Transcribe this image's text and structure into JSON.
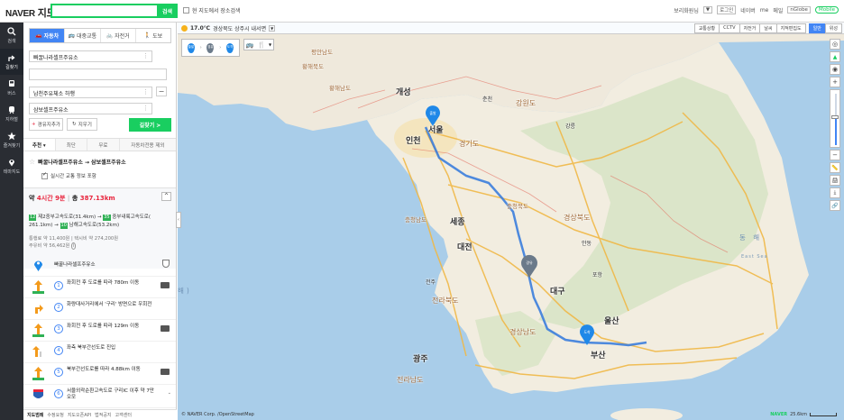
{
  "header": {
    "logo_brand": "NAVER",
    "logo_service": "지도",
    "search_placeholder": "",
    "search_button": "검색",
    "view_search_label": "현 지도에서 장소검색",
    "links": [
      "로그인",
      "네이버",
      "me",
      "메일",
      "nGlobe"
    ],
    "user_label": "보리화원님",
    "user_sel": "▼",
    "mobile_label": "Mobile"
  },
  "leftnav": {
    "items": [
      {
        "label": "검색",
        "icon": "search-icon"
      },
      {
        "label": "길찾기",
        "icon": "directions-icon"
      },
      {
        "label": "버스",
        "icon": "bus-icon"
      },
      {
        "label": "지하철",
        "icon": "subway-icon"
      },
      {
        "label": "즐겨찾기",
        "icon": "star-icon"
      },
      {
        "label": "테마지도",
        "icon": "pin-icon"
      }
    ]
  },
  "route_panel": {
    "modes": [
      "자동차",
      "대중교통",
      "자전거",
      "도보"
    ],
    "start": "빠꿀나라셀프주유소",
    "via": "남천주유체소 하행",
    "end": "삼보셀프주유소",
    "add_via_label": "경유지추가",
    "clear_label": "지우기",
    "find_label": "길찾기 >",
    "option_tabs": [
      "추천 ▾",
      "최단",
      "무료",
      "자동차전용 제외"
    ],
    "favorite_route": "빠꿀나라셀프주유소 → 삼보셀프주유소",
    "realtime_label": "실시간 교통 정보 포함"
  },
  "summary": {
    "time_prefix": "약",
    "time_value": "4시간 9분",
    "dist_prefix": "총",
    "dist_value": "387.13km",
    "roads_line1": "제2중부고속도로(31.4km) →",
    "roads_tag1": "12",
    "roads_tag1b": "35",
    "roads_line1b": "중부내륙고속도로(",
    "roads_line2": "261.1km) →",
    "roads_tag2": "10",
    "roads_line2b": "남해고속도로(53.2km)",
    "toll": "통행료 약 11,400원 | 택시비 약 274,200원",
    "fuel": "주유비 약 56,462원"
  },
  "steps": [
    {
      "num": "",
      "text": "빠꿀나라셀프주유소",
      "badge": ""
    },
    {
      "num": "1",
      "text": "좌회전 후 도로를 따라 780m 이동",
      "badge": "camera"
    },
    {
      "num": "2",
      "text": "화량대사거리에서 '구리' 방면으로 우회전",
      "badge": ""
    },
    {
      "num": "3",
      "text": "좌회전 후 도로를 따라 129m 이동",
      "badge": "camera"
    },
    {
      "num": "4",
      "text": "좌측 북부간선도로 진입",
      "badge": ""
    },
    {
      "num": "5",
      "text": "북부간선도로를 따라 4.88km 이동",
      "badge": "camera"
    },
    {
      "num": "6",
      "text": "서울외곽순환고속도로 구리IC 이후 약 7만 오모",
      "badge": ""
    }
  ],
  "footer": {
    "items": [
      "지도범례",
      "수정요청",
      "지도오픈API",
      "법적공지",
      "고객센터"
    ]
  },
  "map": {
    "weather_temp": "17.0℃",
    "weather_place": "경상북도 상주시 내서면",
    "layers": [
      "교통상황",
      "CCTV",
      "자전거",
      "날씨",
      "지적편집도",
      "일반",
      "위성"
    ],
    "active_layer": "일반",
    "copyright": "© NAVER Corp. /OpenStreetMap",
    "scale_brand": "NAVER",
    "scale_label": "25.6km",
    "zoom_level_fraction": 0.55,
    "labels": {
      "pyongan": "평안남도",
      "hwanghae": "황해남도",
      "hwanghae2": "황해북도",
      "kaesong": "개성",
      "chuncheon": "춘천",
      "gangwon": "강원도",
      "incheon": "인천",
      "seoul": "서울",
      "gyeonggi": "경기도",
      "chungbuk": "충청북도",
      "chungnam": "충청남도",
      "sejong": "세종",
      "daejeon": "대전",
      "gyeongbuk": "경상북도",
      "jeonbuk": "전라북도",
      "daegu": "대구",
      "ulsan": "울산",
      "busan": "부산",
      "gyeongnam": "경상남도",
      "jeonnam": "전라남도",
      "gwangju": "광주",
      "gangneung": "강릉",
      "pohang": "포항",
      "andong": "안동",
      "jeonju": "전주",
      "east_sea": "동   해",
      "east_sea_en": "East Sea",
      "yellow_sea": "해)"
    },
    "pins": {
      "start_label": "출발",
      "via_label": "경유",
      "end_label": "도착"
    },
    "colors": {
      "route": "#3b7ddd",
      "pin_blue": "#1f88e8",
      "pin_gray": "#6b7a8a",
      "naver_green": "#19ce60"
    }
  }
}
